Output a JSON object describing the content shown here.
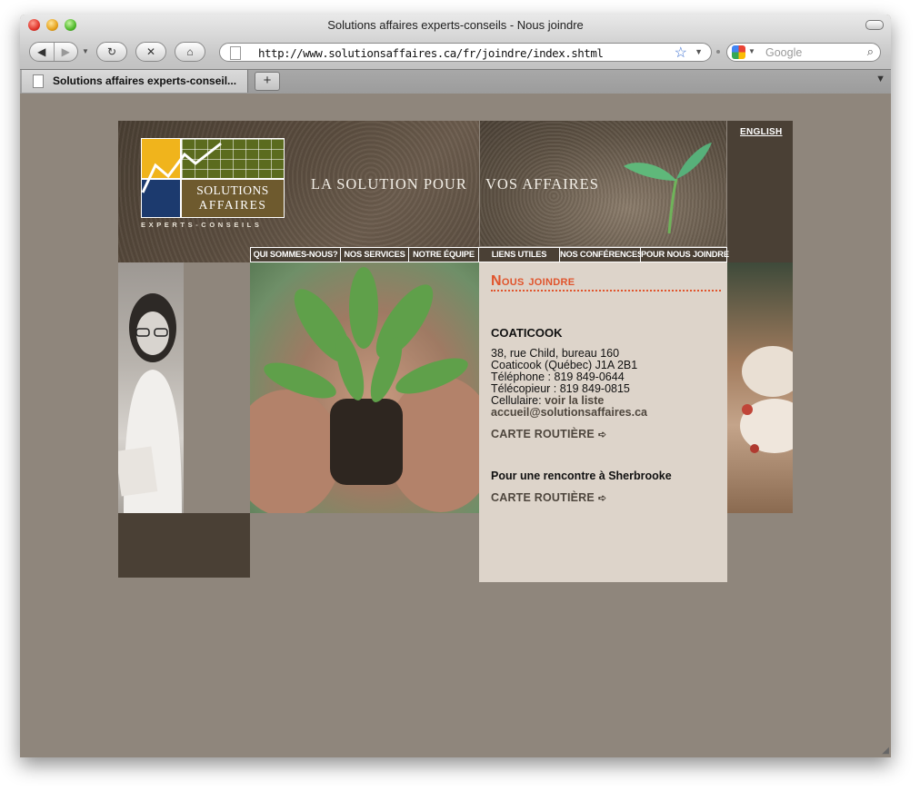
{
  "browser": {
    "window_title": "Solutions affaires experts-conseils - Nous joindre",
    "url": "http://www.solutionsaffaires.ca/fr/joindre/index.shtml",
    "search_placeholder": "Google",
    "tab_label": "Solutions affaires experts-conseil...",
    "new_tab_label": "+"
  },
  "site": {
    "logo_line1": "SOLUTIONS",
    "logo_line2": "AFFAIRES",
    "logo_sub": "EXPERTS-CONSEILS",
    "tagline_left": "LA SOLUTION POUR",
    "tagline_right": "VOS AFFAIRES",
    "language_link": "ENGLISH",
    "menu": [
      {
        "label": "QUI SOMMES-NOUS?"
      },
      {
        "label": "NOS SERVICES"
      },
      {
        "label": "NOTRE ÉQUIPE"
      },
      {
        "label": "LIENS UTILES"
      },
      {
        "label": "NOS CONFÉRENCES"
      },
      {
        "label": "POUR NOUS JOINDRE"
      }
    ],
    "colors": {
      "accent": "#e0542c",
      "dark": "#4a4035",
      "panel": "#ddd4ca",
      "background": "#8f867c"
    }
  },
  "contact": {
    "title": "Nous joindre",
    "city": "COATICOOK",
    "address_line1": "38, rue Child, bureau 160",
    "address_line2": "Coaticook (Québec) J1A 2B1",
    "phone": "Téléphone : 819 849-0644",
    "fax": "Télécopieur : 819 849-0815",
    "cell_label": "Cellulaire: ",
    "cell_link": "voir la liste",
    "email": "accueil@solutionsaffaires.ca",
    "map_link": "CARTE ROUTIÈRE",
    "sherbrooke_title": "Pour une rencontre à Sherbrooke",
    "sherbrooke_map_link": "CARTE ROUTIÈRE",
    "arrow": "➪"
  }
}
